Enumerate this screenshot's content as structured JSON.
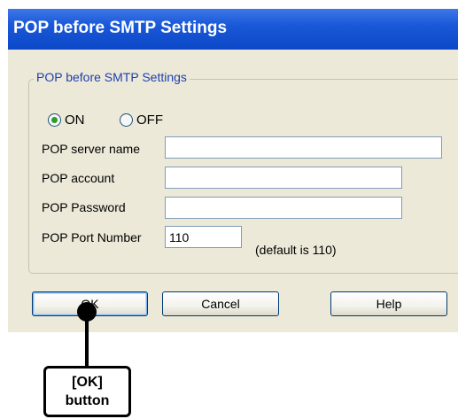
{
  "window": {
    "title": "POP before SMTP Settings"
  },
  "group": {
    "legend": "POP before SMTP Settings",
    "radio_on": {
      "label": "ON",
      "selected": true
    },
    "radio_off": {
      "label": "OFF",
      "selected": false
    },
    "fields": {
      "server_name": {
        "label": "POP server name",
        "value": ""
      },
      "account": {
        "label": "POP account",
        "value": ""
      },
      "password": {
        "label": "POP Password",
        "value": ""
      },
      "port": {
        "label": "POP Port Number",
        "value": "110",
        "hint": "(default is 110)"
      }
    }
  },
  "buttons": {
    "ok": "OK",
    "cancel": "Cancel",
    "help": "Help"
  },
  "callout": {
    "line1": "[OK]",
    "line2": "button"
  },
  "colors": {
    "titlebar": "#0c48c8",
    "dialog_bg": "#ece9d8",
    "legend_text": "#1f40ae",
    "radio_dot": "#2d9d2d"
  }
}
